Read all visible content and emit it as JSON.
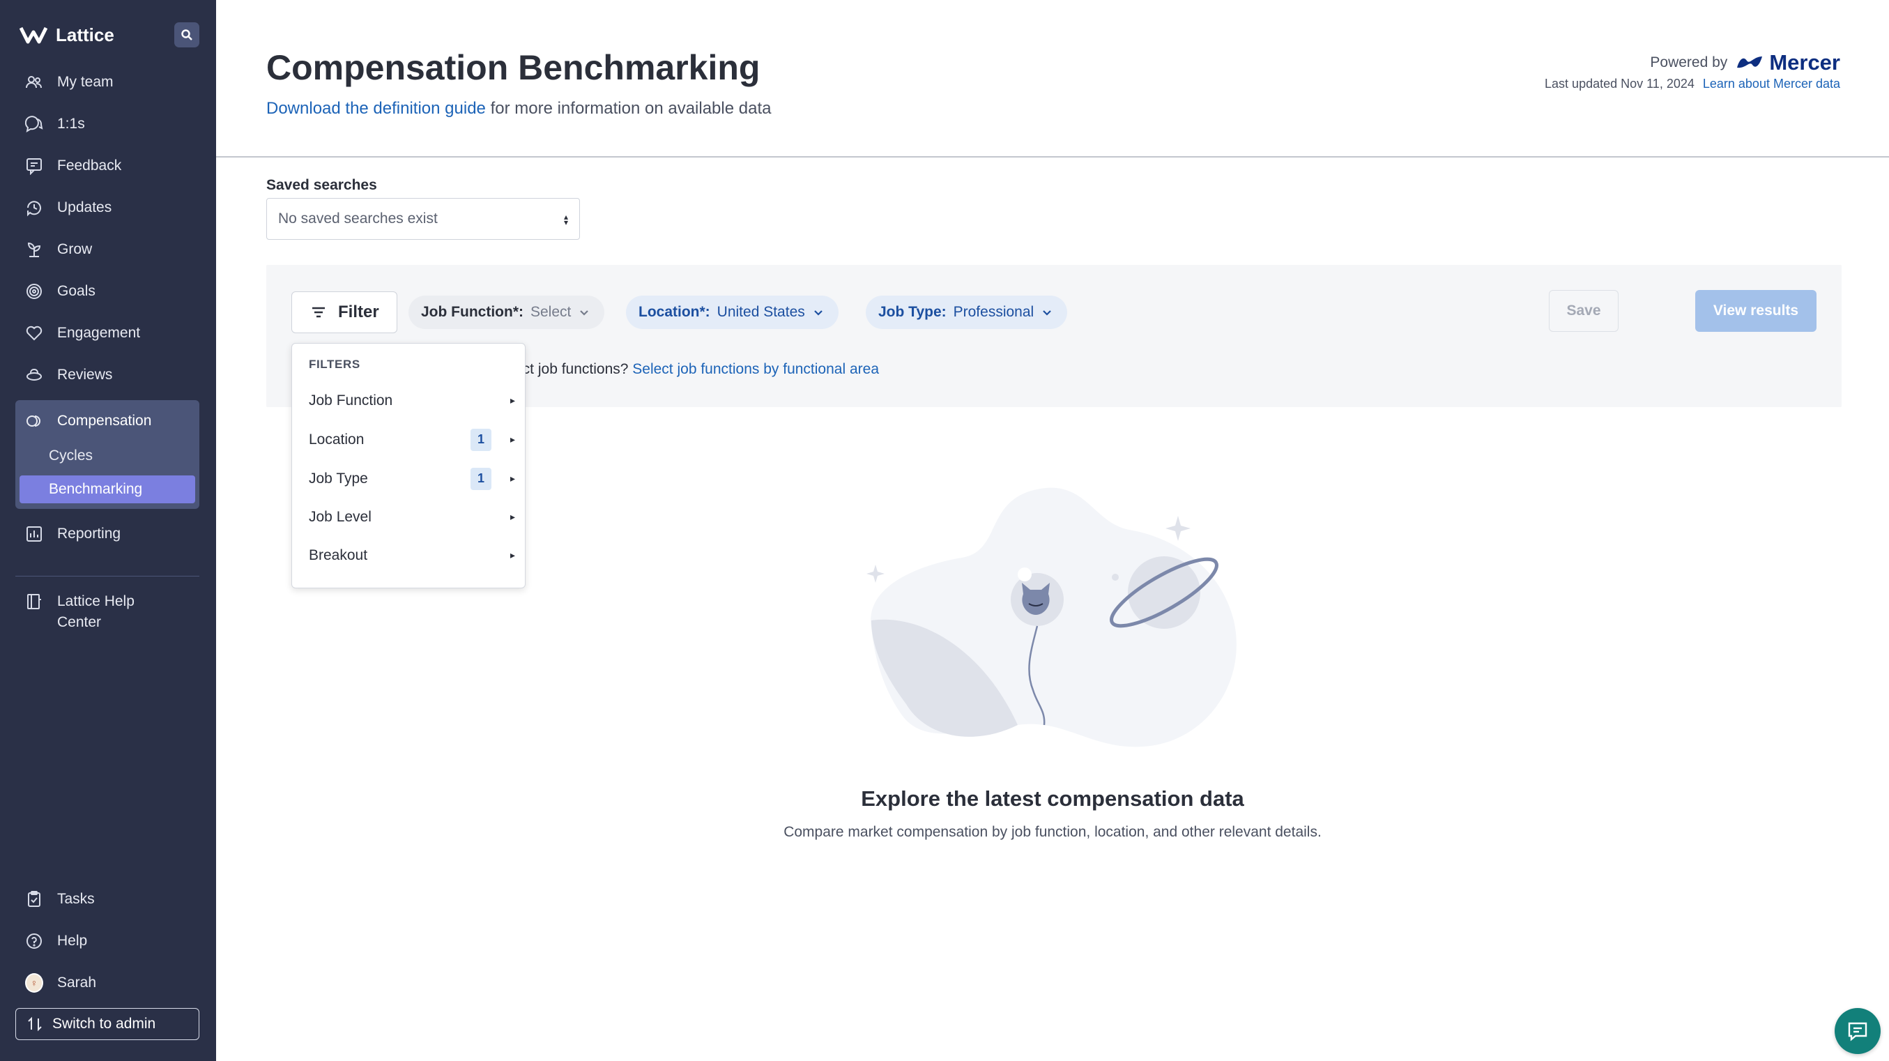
{
  "sidebar": {
    "brand": "Lattice",
    "items": [
      {
        "label": "My team",
        "icon": "people-icon"
      },
      {
        "label": "1:1s",
        "icon": "chat-bubbles-icon"
      },
      {
        "label": "Feedback",
        "icon": "feedback-icon"
      },
      {
        "label": "Updates",
        "icon": "updates-icon"
      },
      {
        "label": "Grow",
        "icon": "sprout-icon"
      },
      {
        "label": "Goals",
        "icon": "target-icon"
      },
      {
        "label": "Engagement",
        "icon": "heart-icon"
      },
      {
        "label": "Reviews",
        "icon": "reviews-icon"
      }
    ],
    "compensation": {
      "label": "Compensation",
      "icon": "compensation-icon",
      "sub_items": [
        "Cycles",
        "Benchmarking"
      ]
    },
    "reporting": "Reporting",
    "help_center": [
      "Lattice Help",
      "Center"
    ],
    "bottom": {
      "tasks": "Tasks",
      "help": "Help",
      "user": "Sarah",
      "switch_admin": "Switch to admin"
    }
  },
  "header": {
    "title": "Compensation Benchmarking",
    "subtitle_link": "Download the definition guide",
    "subtitle_rest": " for more information on available data",
    "powered_by": "Powered by",
    "provider": "Mercer",
    "last_updated": "Last updated Nov 11, 2024",
    "learn_link": "Learn about Mercer data"
  },
  "saved": {
    "label": "Saved searches",
    "value": "No saved searches exist"
  },
  "filters": {
    "button": "Filter",
    "chips": [
      {
        "key": "Job Function*:",
        "value": "Select"
      },
      {
        "key": "Location*:",
        "value": "United States"
      },
      {
        "key": "Job Type:",
        "value": "Professional"
      }
    ],
    "hint_text": "ect job functions? ",
    "hint_link": "Select job functions by functional area",
    "save": "Save",
    "view_results": "View results"
  },
  "menu": {
    "heading": "FILTERS",
    "items": [
      {
        "label": "Job Function",
        "badge": ""
      },
      {
        "label": "Location",
        "badge": "1"
      },
      {
        "label": "Job Type",
        "badge": "1"
      },
      {
        "label": "Job Level",
        "badge": ""
      },
      {
        "label": "Breakout",
        "badge": ""
      }
    ]
  },
  "empty": {
    "title": "Explore the latest compensation data",
    "subtitle": "Compare market compensation by job function, location, and other relevant details."
  },
  "colors": {
    "sidebar_bg": "#2a3047",
    "active_item": "#7b7fe0",
    "link": "#1c63b7",
    "primary_disabled": "#a3c1ea",
    "chat": "#12807a"
  }
}
